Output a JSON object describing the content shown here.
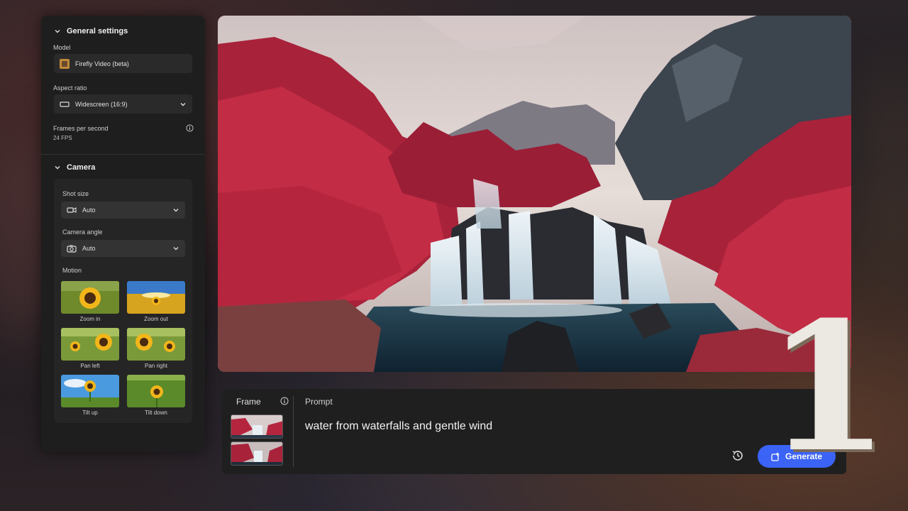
{
  "general": {
    "title": "General settings",
    "model_label": "Model",
    "model_value": "Firefly Video (beta)",
    "aspect_label": "Aspect ratio",
    "aspect_value": "Widescreen (16:9)",
    "fps_label": "Frames per second",
    "fps_value": "24 FPS"
  },
  "camera": {
    "title": "Camera",
    "shot_label": "Shot size",
    "shot_value": "Auto",
    "angle_label": "Camera angle",
    "angle_value": "Auto",
    "motion_label": "Motion",
    "motions": [
      {
        "label": "Zoom in"
      },
      {
        "label": "Zoom out"
      },
      {
        "label": "Pan left"
      },
      {
        "label": "Pan right"
      },
      {
        "label": "Tilt up"
      },
      {
        "label": "Tilt down"
      }
    ]
  },
  "bar": {
    "frame_label": "Frame",
    "prompt_label": "Prompt",
    "prompt_text": "water from waterfalls and gentle wind",
    "generate_label": "Generate"
  },
  "overlay": {
    "number": "1"
  },
  "colors": {
    "accent": "#3b63f6",
    "panel": "#1e1e1e",
    "foliage": "#b0263a"
  }
}
